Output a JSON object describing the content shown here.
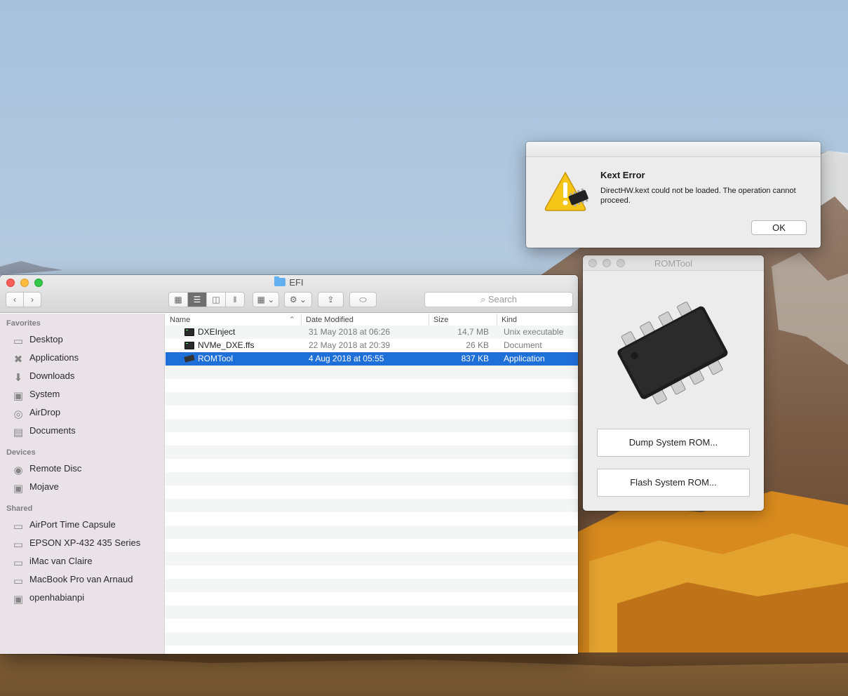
{
  "finder": {
    "title": "EFI",
    "search_placeholder": "Search",
    "sidebar": {
      "favorites_header": "Favorites",
      "favorites": [
        {
          "label": "Desktop",
          "icon": "desktop-icon"
        },
        {
          "label": "Applications",
          "icon": "applications-icon"
        },
        {
          "label": "Downloads",
          "icon": "downloads-icon"
        },
        {
          "label": "System",
          "icon": "disk-icon"
        },
        {
          "label": "AirDrop",
          "icon": "airdrop-icon"
        },
        {
          "label": "Documents",
          "icon": "documents-icon"
        }
      ],
      "devices_header": "Devices",
      "devices": [
        {
          "label": "Remote Disc",
          "icon": "remote-disc-icon"
        },
        {
          "label": "Mojave",
          "icon": "disk-icon"
        }
      ],
      "shared_header": "Shared",
      "shared": [
        {
          "label": "AirPort Time Capsule",
          "icon": "computer-icon"
        },
        {
          "label": "EPSON XP-432 435 Series",
          "icon": "computer-icon"
        },
        {
          "label": "iMac van Claire",
          "icon": "computer-icon"
        },
        {
          "label": "MacBook Pro van Arnaud",
          "icon": "computer-icon"
        },
        {
          "label": "openhabianpi",
          "icon": "computer-icon"
        }
      ]
    },
    "columns": {
      "name": "Name",
      "date": "Date Modified",
      "size": "Size",
      "kind": "Kind"
    },
    "files": [
      {
        "name": "DXEInject",
        "date": "31 May 2018 at 06:26",
        "size": "14,7 MB",
        "kind": "Unix executable"
      },
      {
        "name": "NVMe_DXE.ffs",
        "date": "22 May 2018 at 20:39",
        "size": "26 KB",
        "kind": "Document"
      },
      {
        "name": "ROMTool",
        "date": "4 Aug 2018 at 05:55",
        "size": "837 KB",
        "kind": "Application"
      }
    ]
  },
  "romtool": {
    "title": "ROMTool",
    "dump_label": "Dump System ROM...",
    "flash_label": "Flash System ROM..."
  },
  "alert": {
    "title": "Kext Error",
    "message": "DirectHW.kext could not be loaded. The operation cannot proceed.",
    "ok_label": "OK"
  },
  "colors": {
    "selection": "#1e6fd8",
    "close": "#fc605c",
    "minimize": "#fdbc40",
    "zoom": "#34c84a"
  }
}
